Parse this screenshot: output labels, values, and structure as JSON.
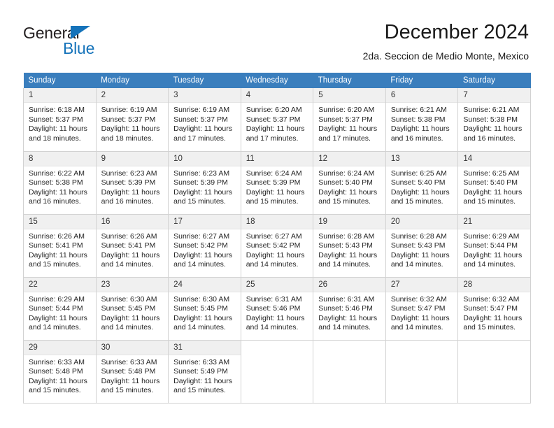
{
  "brand": {
    "name_top": "General",
    "name_bottom": "Blue",
    "triangle_icon": "blue-triangle-logo-mark",
    "accent_color": "#1573ba"
  },
  "header": {
    "title": "December 2024",
    "subtitle": "2da. Seccion de Medio Monte, Mexico"
  },
  "theme": {
    "header_row_bg": "#3a7ebd",
    "daynum_bg": "#f0f0f0",
    "border": "#d2d2d2",
    "text": "#242424"
  },
  "weekdays": [
    "Sunday",
    "Monday",
    "Tuesday",
    "Wednesday",
    "Thursday",
    "Friday",
    "Saturday"
  ],
  "labels": {
    "sunrise": "Sunrise:",
    "sunset": "Sunset:",
    "daylight": "Daylight:"
  },
  "weeks": [
    [
      {
        "day": "1",
        "sunrise": "Sunrise: 6:18 AM",
        "sunset": "Sunset: 5:37 PM",
        "daylight1": "Daylight: 11 hours",
        "daylight2": "and 18 minutes."
      },
      {
        "day": "2",
        "sunrise": "Sunrise: 6:19 AM",
        "sunset": "Sunset: 5:37 PM",
        "daylight1": "Daylight: 11 hours",
        "daylight2": "and 18 minutes."
      },
      {
        "day": "3",
        "sunrise": "Sunrise: 6:19 AM",
        "sunset": "Sunset: 5:37 PM",
        "daylight1": "Daylight: 11 hours",
        "daylight2": "and 17 minutes."
      },
      {
        "day": "4",
        "sunrise": "Sunrise: 6:20 AM",
        "sunset": "Sunset: 5:37 PM",
        "daylight1": "Daylight: 11 hours",
        "daylight2": "and 17 minutes."
      },
      {
        "day": "5",
        "sunrise": "Sunrise: 6:20 AM",
        "sunset": "Sunset: 5:37 PM",
        "daylight1": "Daylight: 11 hours",
        "daylight2": "and 17 minutes."
      },
      {
        "day": "6",
        "sunrise": "Sunrise: 6:21 AM",
        "sunset": "Sunset: 5:38 PM",
        "daylight1": "Daylight: 11 hours",
        "daylight2": "and 16 minutes."
      },
      {
        "day": "7",
        "sunrise": "Sunrise: 6:21 AM",
        "sunset": "Sunset: 5:38 PM",
        "daylight1": "Daylight: 11 hours",
        "daylight2": "and 16 minutes."
      }
    ],
    [
      {
        "day": "8",
        "sunrise": "Sunrise: 6:22 AM",
        "sunset": "Sunset: 5:38 PM",
        "daylight1": "Daylight: 11 hours",
        "daylight2": "and 16 minutes."
      },
      {
        "day": "9",
        "sunrise": "Sunrise: 6:23 AM",
        "sunset": "Sunset: 5:39 PM",
        "daylight1": "Daylight: 11 hours",
        "daylight2": "and 16 minutes."
      },
      {
        "day": "10",
        "sunrise": "Sunrise: 6:23 AM",
        "sunset": "Sunset: 5:39 PM",
        "daylight1": "Daylight: 11 hours",
        "daylight2": "and 15 minutes."
      },
      {
        "day": "11",
        "sunrise": "Sunrise: 6:24 AM",
        "sunset": "Sunset: 5:39 PM",
        "daylight1": "Daylight: 11 hours",
        "daylight2": "and 15 minutes."
      },
      {
        "day": "12",
        "sunrise": "Sunrise: 6:24 AM",
        "sunset": "Sunset: 5:40 PM",
        "daylight1": "Daylight: 11 hours",
        "daylight2": "and 15 minutes."
      },
      {
        "day": "13",
        "sunrise": "Sunrise: 6:25 AM",
        "sunset": "Sunset: 5:40 PM",
        "daylight1": "Daylight: 11 hours",
        "daylight2": "and 15 minutes."
      },
      {
        "day": "14",
        "sunrise": "Sunrise: 6:25 AM",
        "sunset": "Sunset: 5:40 PM",
        "daylight1": "Daylight: 11 hours",
        "daylight2": "and 15 minutes."
      }
    ],
    [
      {
        "day": "15",
        "sunrise": "Sunrise: 6:26 AM",
        "sunset": "Sunset: 5:41 PM",
        "daylight1": "Daylight: 11 hours",
        "daylight2": "and 15 minutes."
      },
      {
        "day": "16",
        "sunrise": "Sunrise: 6:26 AM",
        "sunset": "Sunset: 5:41 PM",
        "daylight1": "Daylight: 11 hours",
        "daylight2": "and 14 minutes."
      },
      {
        "day": "17",
        "sunrise": "Sunrise: 6:27 AM",
        "sunset": "Sunset: 5:42 PM",
        "daylight1": "Daylight: 11 hours",
        "daylight2": "and 14 minutes."
      },
      {
        "day": "18",
        "sunrise": "Sunrise: 6:27 AM",
        "sunset": "Sunset: 5:42 PM",
        "daylight1": "Daylight: 11 hours",
        "daylight2": "and 14 minutes."
      },
      {
        "day": "19",
        "sunrise": "Sunrise: 6:28 AM",
        "sunset": "Sunset: 5:43 PM",
        "daylight1": "Daylight: 11 hours",
        "daylight2": "and 14 minutes."
      },
      {
        "day": "20",
        "sunrise": "Sunrise: 6:28 AM",
        "sunset": "Sunset: 5:43 PM",
        "daylight1": "Daylight: 11 hours",
        "daylight2": "and 14 minutes."
      },
      {
        "day": "21",
        "sunrise": "Sunrise: 6:29 AM",
        "sunset": "Sunset: 5:44 PM",
        "daylight1": "Daylight: 11 hours",
        "daylight2": "and 14 minutes."
      }
    ],
    [
      {
        "day": "22",
        "sunrise": "Sunrise: 6:29 AM",
        "sunset": "Sunset: 5:44 PM",
        "daylight1": "Daylight: 11 hours",
        "daylight2": "and 14 minutes."
      },
      {
        "day": "23",
        "sunrise": "Sunrise: 6:30 AM",
        "sunset": "Sunset: 5:45 PM",
        "daylight1": "Daylight: 11 hours",
        "daylight2": "and 14 minutes."
      },
      {
        "day": "24",
        "sunrise": "Sunrise: 6:30 AM",
        "sunset": "Sunset: 5:45 PM",
        "daylight1": "Daylight: 11 hours",
        "daylight2": "and 14 minutes."
      },
      {
        "day": "25",
        "sunrise": "Sunrise: 6:31 AM",
        "sunset": "Sunset: 5:46 PM",
        "daylight1": "Daylight: 11 hours",
        "daylight2": "and 14 minutes."
      },
      {
        "day": "26",
        "sunrise": "Sunrise: 6:31 AM",
        "sunset": "Sunset: 5:46 PM",
        "daylight1": "Daylight: 11 hours",
        "daylight2": "and 14 minutes."
      },
      {
        "day": "27",
        "sunrise": "Sunrise: 6:32 AM",
        "sunset": "Sunset: 5:47 PM",
        "daylight1": "Daylight: 11 hours",
        "daylight2": "and 14 minutes."
      },
      {
        "day": "28",
        "sunrise": "Sunrise: 6:32 AM",
        "sunset": "Sunset: 5:47 PM",
        "daylight1": "Daylight: 11 hours",
        "daylight2": "and 15 minutes."
      }
    ],
    [
      {
        "day": "29",
        "sunrise": "Sunrise: 6:33 AM",
        "sunset": "Sunset: 5:48 PM",
        "daylight1": "Daylight: 11 hours",
        "daylight2": "and 15 minutes."
      },
      {
        "day": "30",
        "sunrise": "Sunrise: 6:33 AM",
        "sunset": "Sunset: 5:48 PM",
        "daylight1": "Daylight: 11 hours",
        "daylight2": "and 15 minutes."
      },
      {
        "day": "31",
        "sunrise": "Sunrise: 6:33 AM",
        "sunset": "Sunset: 5:49 PM",
        "daylight1": "Daylight: 11 hours",
        "daylight2": "and 15 minutes."
      },
      {
        "day": "",
        "sunrise": "",
        "sunset": "",
        "daylight1": "",
        "daylight2": ""
      },
      {
        "day": "",
        "sunrise": "",
        "sunset": "",
        "daylight1": "",
        "daylight2": ""
      },
      {
        "day": "",
        "sunrise": "",
        "sunset": "",
        "daylight1": "",
        "daylight2": ""
      },
      {
        "day": "",
        "sunrise": "",
        "sunset": "",
        "daylight1": "",
        "daylight2": ""
      }
    ]
  ]
}
